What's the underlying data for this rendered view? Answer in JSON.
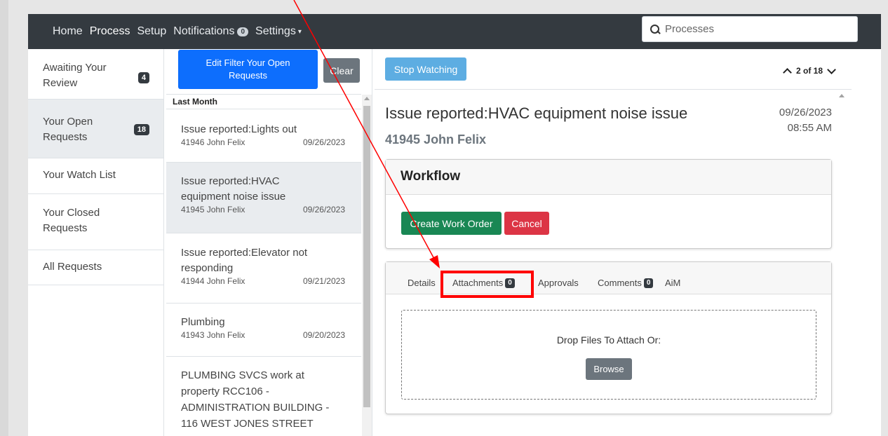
{
  "nav": {
    "items": [
      {
        "label": "Home"
      },
      {
        "label": "Process"
      },
      {
        "label": "Setup"
      },
      {
        "label": "Notifications"
      },
      {
        "label": "Settings"
      }
    ],
    "notifications_count": "0",
    "search_placeholder": "Processes"
  },
  "sidebar": {
    "items": [
      {
        "label": "Awaiting Your Review",
        "badge": "4"
      },
      {
        "label": "Your Open Requests",
        "badge": "18"
      },
      {
        "label": "Your Watch List"
      },
      {
        "label": "Your Closed Requests"
      },
      {
        "label": "All Requests"
      }
    ]
  },
  "list": {
    "edit_filter_label": "Edit Filter Your Open Requests",
    "clear_label": "Clear",
    "group_header": "Last Month",
    "requests": [
      {
        "title": "Issue reported:Lights out",
        "id_user": "41946 John Felix",
        "date": "09/26/2023"
      },
      {
        "title": "Issue reported:HVAC equipment noise issue",
        "id_user": "41945 John Felix",
        "date": "09/26/2023"
      },
      {
        "title": "Issue reported:Elevator not responding",
        "id_user": "41944 John Felix",
        "date": "09/21/2023"
      },
      {
        "title": "Plumbing",
        "id_user": "41943 John Felix",
        "date": "09/20/2023"
      },
      {
        "title": "PLUMBING SVCS work at property RCC106 - ADMINISTRATION BUILDING - 116 WEST JONES STREET"
      }
    ]
  },
  "detail": {
    "stop_watching_label": "Stop Watching",
    "pager": "2 of 18",
    "title": "Issue reported:HVAC equipment noise issue",
    "subtitle": "41945 John Felix",
    "date": "09/26/2023",
    "time": "08:55 AM",
    "workflow": {
      "header": "Workflow",
      "create_work_order_label": "Create Work Order",
      "cancel_label": "Cancel"
    },
    "tabs": [
      {
        "label": "Details"
      },
      {
        "label": "Attachments",
        "badge": "0"
      },
      {
        "label": "Approvals"
      },
      {
        "label": "Comments",
        "badge": "0"
      },
      {
        "label": "AiM"
      }
    ],
    "drop_text": "Drop Files To Attach Or:",
    "browse_label": "Browse"
  },
  "colors": {
    "navbar": "#343a40",
    "primary": "#0d6efd",
    "success": "#198754",
    "danger": "#dc3545",
    "info": "#5dade2",
    "annotation": "#ff0000"
  }
}
